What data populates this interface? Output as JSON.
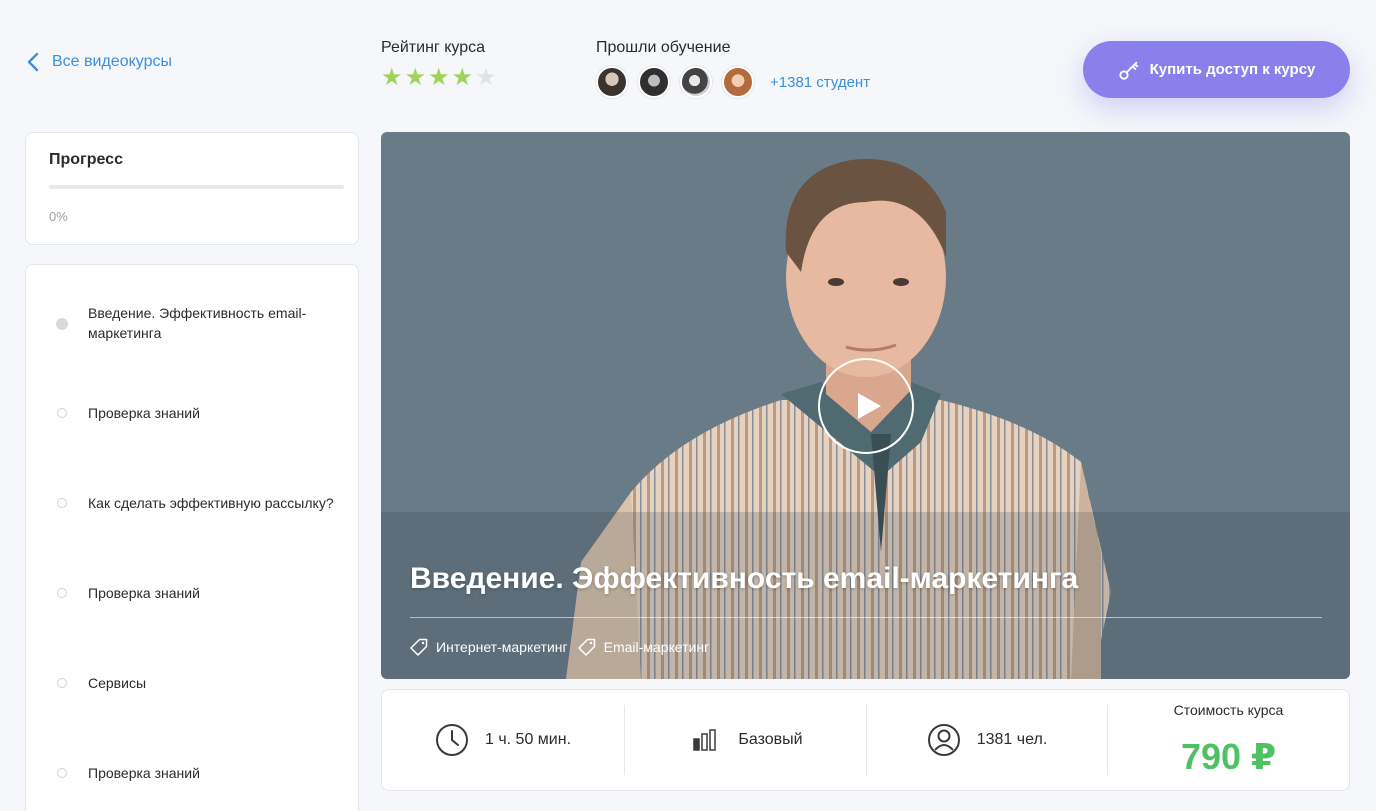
{
  "header": {
    "back_label": "Все видеокурсы",
    "rating_label": "Рейтинг курса",
    "rating_value": 4,
    "rating_max": 5,
    "passed_label": "Прошли обучение",
    "students_text": "+1381 студент",
    "buy_label": "Купить доступ к курсу"
  },
  "progress": {
    "title": "Прогресс",
    "value_text": "0%",
    "value": 0
  },
  "lessons": [
    {
      "title": "Введение. Эффективность email-маркетинга",
      "active": true
    },
    {
      "title": "Проверка знаний",
      "active": false
    },
    {
      "title": "Как сделать эффективную рассылку?",
      "active": false
    },
    {
      "title": "Проверка знаний",
      "active": false
    },
    {
      "title": "Сервисы",
      "active": false
    },
    {
      "title": "Проверка знаний",
      "active": false
    }
  ],
  "video": {
    "title": "Введение. Эффективность email-маркетинга",
    "tags": [
      "Интернет-маркетинг",
      "Email-маркетинг"
    ]
  },
  "stats": {
    "duration": "1 ч. 50 мин.",
    "level": "Базовый",
    "students": "1381 чел.",
    "price_label": "Стоимость курса",
    "price": "790 ₽"
  },
  "colors": {
    "accent": "#8a80ec",
    "link": "#3b8fd9",
    "star": "#9fd45a",
    "price": "#4fc163"
  }
}
